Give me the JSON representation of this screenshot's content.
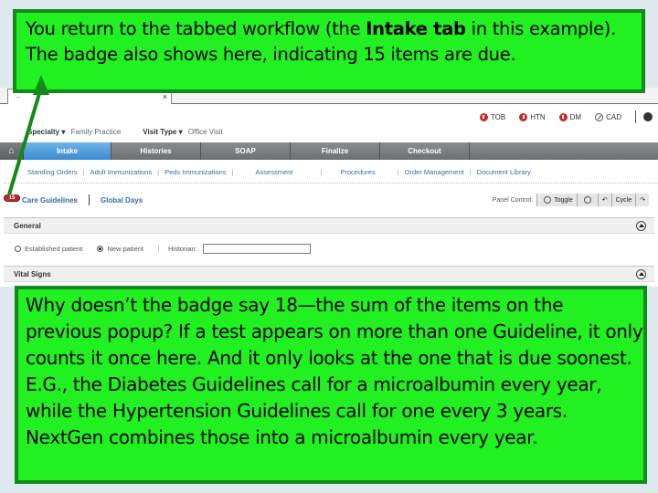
{
  "browser": {
    "tab_title": "...",
    "tab_close": "×"
  },
  "header": {
    "alerts": [
      {
        "label": "TOB",
        "status": "alert",
        "color": "#c8282a"
      },
      {
        "label": "HTN",
        "status": "alert",
        "color": "#c8282a"
      },
      {
        "label": "DM",
        "status": "alert",
        "color": "#c8282a"
      },
      {
        "label": "CAD",
        "status": "none"
      }
    ],
    "settings_icon": "gear-icon"
  },
  "filters": {
    "specialty_label": "Specialty ▾",
    "specialty_value": "Family Practice",
    "visit_type_label": "Visit Type ▾",
    "visit_type_value": "Office Visit"
  },
  "main_tabs": {
    "home_icon": "⌂",
    "items": [
      {
        "label": "Intake",
        "active": true
      },
      {
        "label": "Histories"
      },
      {
        "label": "SOAP"
      },
      {
        "label": "Finalize"
      },
      {
        "label": "Checkout"
      }
    ]
  },
  "sub_tabs": [
    "Standing Orders",
    "Adult Immunizations",
    "Peds Immunizations",
    "Assessment",
    "Procedures",
    "Order Management",
    "Document Library"
  ],
  "section_tabs": {
    "badge_count": "15",
    "items": [
      "Care Guidelines",
      "Global Days"
    ]
  },
  "panel_control": {
    "label": "Panel Control:",
    "toggle": "Toggle",
    "cycle": "Cycle"
  },
  "sections": {
    "general": {
      "title": "General",
      "established_label": "Established patient",
      "new_label": "New patient",
      "historian_label": "Historian:",
      "historian_value": "",
      "selected": "New patient"
    },
    "vital_signs": {
      "title": "Vital Signs"
    }
  },
  "callouts": {
    "top": {
      "part1": "You return to the tabbed workflow (the ",
      "bold": "Intake tab",
      "part2": " in this example).  The badge also shows here, indicating 15 items are due."
    },
    "bottom": "Why doesn’t the badge say 18—the sum of the items on the previous popup?  If a test appears on more than one Guideline, it only counts it once here.  And it only looks at the one that is due soonest.  E.G., the Diabetes Guidelines call for a microalbumin every year, while the Hypertension Guidelines call for one every 3 years.  NextGen combines those into a microalbumin every year."
  },
  "colors": {
    "callout_fill": "#21f021",
    "callout_border": "#138a1b",
    "active_tab": "#3b8ad0",
    "badge": "#b52a2a"
  }
}
